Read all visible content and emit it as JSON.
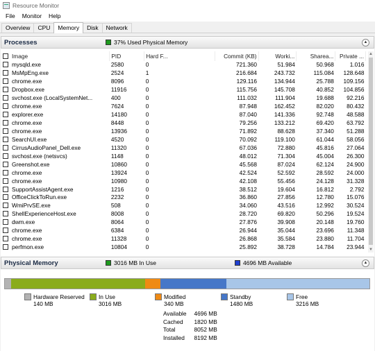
{
  "window": {
    "title": "Resource Monitor"
  },
  "menu": [
    "File",
    "Monitor",
    "Help"
  ],
  "tabs": [
    "Overview",
    "CPU",
    "Memory",
    "Disk",
    "Network"
  ],
  "processes": {
    "title": "Processes",
    "used_label": "37% Used Physical Memory",
    "used_color": "#1e9a1e",
    "columns": [
      "Image",
      "PID",
      "Hard F...",
      "Commit (KB)",
      "Worki...",
      "Sharea...",
      "Private ..."
    ],
    "rows": [
      [
        "mysqld.exe",
        "2580",
        "0",
        "721.360",
        "51.984",
        "50.968",
        "1.016"
      ],
      [
        "MsMpEng.exe",
        "2524",
        "1",
        "216.684",
        "243.732",
        "115.084",
        "128.648"
      ],
      [
        "chrome.exe",
        "8096",
        "0",
        "129.116",
        "134.944",
        "25.788",
        "109.156"
      ],
      [
        "Dropbox.exe",
        "11916",
        "0",
        "115.756",
        "145.708",
        "40.852",
        "104.856"
      ],
      [
        "svchost.exe (LocalSystemNet...",
        "400",
        "0",
        "111.032",
        "111.904",
        "19.688",
        "92.216"
      ],
      [
        "chrome.exe",
        "7624",
        "0",
        "87.948",
        "162.452",
        "82.020",
        "80.432"
      ],
      [
        "explorer.exe",
        "14180",
        "0",
        "87.040",
        "141.336",
        "92.748",
        "48.588"
      ],
      [
        "chrome.exe",
        "8448",
        "0",
        "79.256",
        "133.212",
        "69.420",
        "63.792"
      ],
      [
        "chrome.exe",
        "13936",
        "0",
        "71.892",
        "88.628",
        "37.340",
        "51.288"
      ],
      [
        "SearchUI.exe",
        "4520",
        "0",
        "70.092",
        "119.100",
        "61.044",
        "58.056"
      ],
      [
        "CirrusAudioPanel_Dell.exe",
        "11320",
        "0",
        "67.036",
        "72.880",
        "45.816",
        "27.064"
      ],
      [
        "svchost.exe (netsvcs)",
        "1148",
        "0",
        "48.012",
        "71.304",
        "45.004",
        "26.300"
      ],
      [
        "Greenshot.exe",
        "10860",
        "0",
        "45.568",
        "87.024",
        "62.124",
        "24.900"
      ],
      [
        "chrome.exe",
        "13924",
        "0",
        "42.524",
        "52.592",
        "28.592",
        "24.000"
      ],
      [
        "chrome.exe",
        "10980",
        "0",
        "42.108",
        "55.456",
        "24.128",
        "31.328"
      ],
      [
        "SupportAssistAgent.exe",
        "1216",
        "0",
        "38.512",
        "19.604",
        "16.812",
        "2.792"
      ],
      [
        "OfficeClickToRun.exe",
        "2232",
        "0",
        "36.860",
        "27.856",
        "12.780",
        "15.076"
      ],
      [
        "WmiPrvSE.exe",
        "508",
        "0",
        "34.060",
        "43.516",
        "12.992",
        "30.524"
      ],
      [
        "ShellExperienceHost.exe",
        "8008",
        "0",
        "28.720",
        "69.820",
        "50.296",
        "19.524"
      ],
      [
        "dwm.exe",
        "8064",
        "0",
        "27.876",
        "39.908",
        "20.148",
        "19.760"
      ],
      [
        "chrome.exe",
        "6384",
        "0",
        "26.944",
        "35.044",
        "23.696",
        "11.348"
      ],
      [
        "chrome.exe",
        "11328",
        "0",
        "26.868",
        "35.584",
        "23.880",
        "11.704"
      ],
      [
        "perfmon.exe",
        "10804",
        "0",
        "25.892",
        "38.728",
        "14.784",
        "23.944"
      ]
    ]
  },
  "physical_memory": {
    "title": "Physical Memory",
    "in_use_label": "3016 MB In Use",
    "in_use_color": "#1e9a1e",
    "available_label": "4696 MB Available",
    "available_color": "#1f3fd0",
    "bar": {
      "total_mb": 8192,
      "segments": [
        {
          "name": "Hardware Reserved",
          "mb": 140,
          "color": "#b3b3b3"
        },
        {
          "name": "In Use",
          "mb": 3016,
          "color": "#8aac1c"
        },
        {
          "name": "Modified",
          "mb": 340,
          "color": "#ef8a14"
        },
        {
          "name": "Standby",
          "mb": 1480,
          "color": "#4677c8"
        },
        {
          "name": "Free",
          "mb": 3216,
          "color": "#a8c6e8"
        }
      ]
    },
    "legend": [
      {
        "name": "Hardware Reserved",
        "value": "140 MB",
        "color": "#b3b3b3"
      },
      {
        "name": "In Use",
        "value": "3016 MB",
        "color": "#8aac1c"
      },
      {
        "name": "Modified",
        "value": "340 MB",
        "color": "#ef8a14"
      },
      {
        "name": "Standby",
        "value": "1480 MB",
        "color": "#4677c8"
      },
      {
        "name": "Free",
        "value": "3216 MB",
        "color": "#a8c6e8"
      }
    ],
    "stats": [
      {
        "label": "Available",
        "value": "4696 MB"
      },
      {
        "label": "Cached",
        "value": "1820 MB"
      },
      {
        "label": "Total",
        "value": "8052 MB"
      },
      {
        "label": "Installed",
        "value": "8192 MB"
      }
    ]
  }
}
